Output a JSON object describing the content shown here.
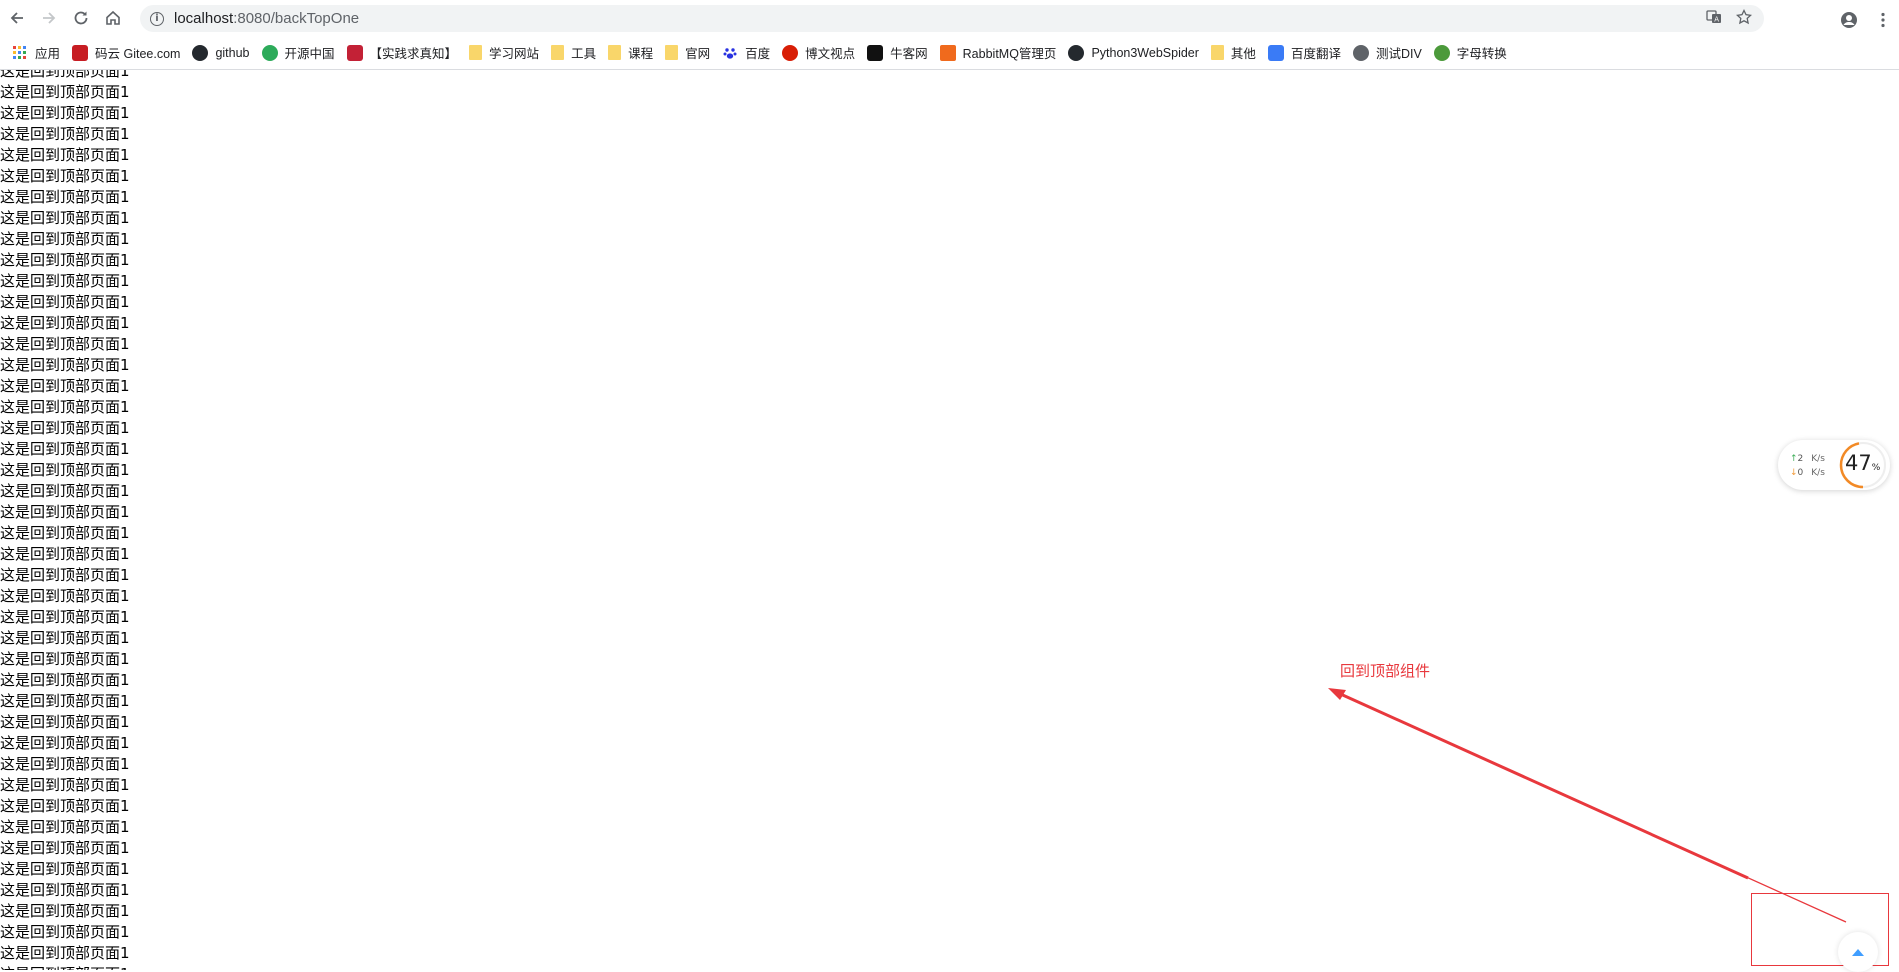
{
  "browser": {
    "url_host": "localhost",
    "url_path": ":8080/backTopOne",
    "bookmarks": [
      {
        "label": "应用",
        "icon": "apps-grid-icon",
        "color": "#e8453c"
      },
      {
        "label": "码云 Gitee.com",
        "icon": "gitee-icon",
        "color": "#c71d23"
      },
      {
        "label": "github",
        "icon": "github-icon",
        "color": "#24292e"
      },
      {
        "label": "开源中国",
        "icon": "oschina-icon",
        "color": "#2dab5a"
      },
      {
        "label": "【实践求真知】",
        "icon": "csdn-icon",
        "color": "#c32136"
      },
      {
        "label": "学习网站",
        "icon": "folder-icon",
        "color": "#f9d66a"
      },
      {
        "label": "工具",
        "icon": "folder-icon",
        "color": "#f9d66a"
      },
      {
        "label": "课程",
        "icon": "folder-icon",
        "color": "#f9d66a"
      },
      {
        "label": "官网",
        "icon": "folder-icon",
        "color": "#f9d66a"
      },
      {
        "label": "百度",
        "icon": "baidu-paw-icon",
        "color": "#2932e1"
      },
      {
        "label": "博文视点",
        "icon": "broadview-icon",
        "color": "#d81e06"
      },
      {
        "label": "牛客网",
        "icon": "nowcoder-icon",
        "color": "#111111"
      },
      {
        "label": "RabbitMQ管理页",
        "icon": "rabbitmq-icon",
        "color": "#f06a1d"
      },
      {
        "label": "Python3WebSpider",
        "icon": "github-icon",
        "color": "#24292e"
      },
      {
        "label": "其他",
        "icon": "folder-icon",
        "color": "#f9d66a"
      },
      {
        "label": "百度翻译",
        "icon": "baidu-translate-icon",
        "color": "#3a7bf6"
      },
      {
        "label": "测试DIV",
        "icon": "globe-icon",
        "color": "#5f6368"
      },
      {
        "label": "字母转换",
        "icon": "frog-icon",
        "color": "#4c9a3b"
      }
    ]
  },
  "page": {
    "line_text": "这是回到顶部页面1",
    "line_count": 44
  },
  "annotation": {
    "label": "回到顶部组件",
    "color": "#e8383d"
  },
  "speed_widget": {
    "upload": "2",
    "download": "0",
    "unit": "K/s",
    "percent": "47",
    "percent_sign": "%",
    "gauge_fraction": 0.47
  },
  "back_top": {
    "accent": "#409eff"
  }
}
